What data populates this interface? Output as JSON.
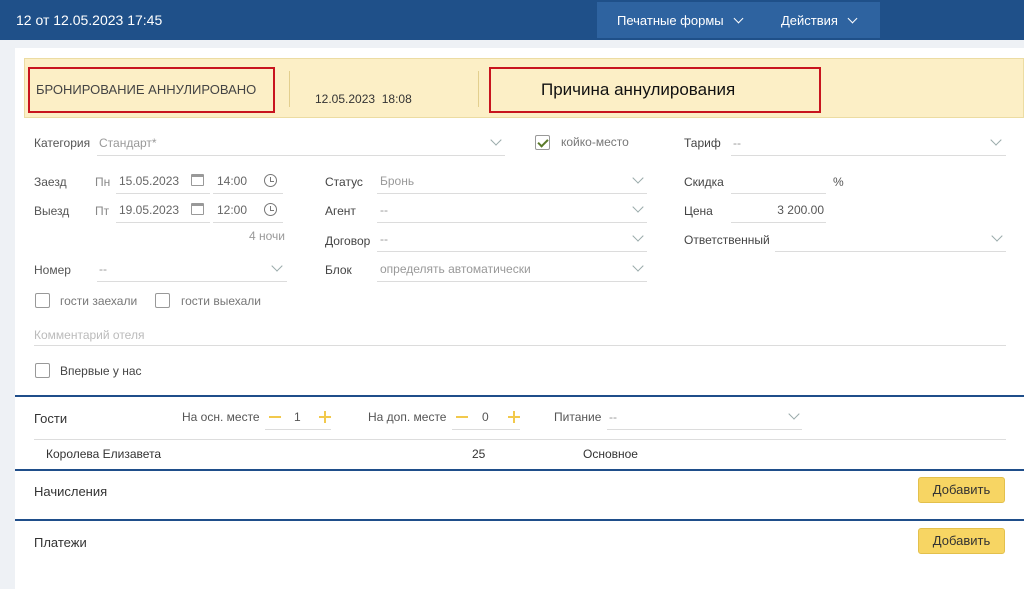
{
  "header": {
    "title": "12 от 12.05.2023 17:45",
    "print_forms": "Печатные формы",
    "actions": "Действия"
  },
  "banner": {
    "status": "БРОНИРОВАНИЕ АННУЛИРОВАНО",
    "date": "12.05.2023",
    "time": "18:08",
    "reason": "Причина аннулирования"
  },
  "form": {
    "category_label": "Категория",
    "category_value": "Стандарт*",
    "bed_label": "койко-место",
    "tariff_label": "Тариф",
    "tariff_value": "--",
    "checkin_label": "Заезд",
    "checkin_day": "Пн",
    "checkin_date": "15.05.2023",
    "checkin_time": "14:00",
    "checkout_label": "Выезд",
    "checkout_day": "Пт",
    "checkout_date": "19.05.2023",
    "checkout_time": "12:00",
    "nights": "4 ночи",
    "status_label": "Статус",
    "status_value": "Бронь",
    "agent_label": "Агент",
    "agent_value": "--",
    "contract_label": "Договор",
    "contract_value": "--",
    "block_label": "Блок",
    "block_value": "определять автоматически",
    "discount_label": "Скидка",
    "discount_unit": "%",
    "price_label": "Цена",
    "price_value": "3 200.00",
    "responsible_label": "Ответственный",
    "room_label": "Номер",
    "room_value": "--",
    "guests_in": "гости заехали",
    "guests_out": "гости выехали",
    "comment_placeholder": "Комментарий отеля",
    "first_time": "Впервые у нас"
  },
  "guests": {
    "title": "Гости",
    "main_place_label": "На осн. месте",
    "main_place_value": "1",
    "extra_place_label": "На доп. месте",
    "extra_place_value": "0",
    "meal_label": "Питание",
    "meal_value": "--",
    "rows": [
      {
        "name": "Королева Елизавета",
        "age": "25",
        "type": "Основное"
      }
    ]
  },
  "charges": {
    "title": "Начисления",
    "add": "Добавить"
  },
  "payments": {
    "title": "Платежи",
    "add": "Добавить"
  },
  "colors": {
    "header": "#1f5089",
    "banner": "#fcefc6",
    "highlight": "#c8141e",
    "button": "#f7d563"
  }
}
